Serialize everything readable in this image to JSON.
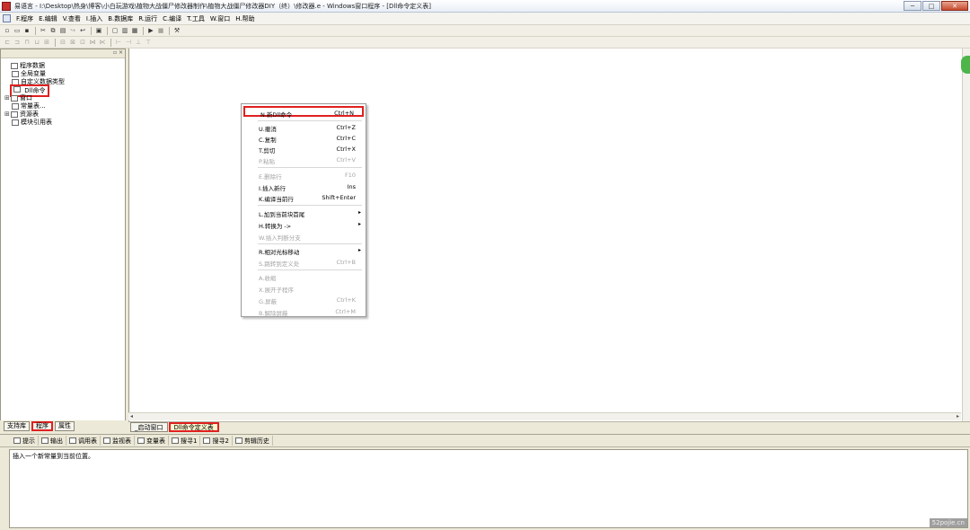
{
  "window": {
    "title": "易语言 - I:\\Desktop\\热身\\博客\\小白玩游戏\\植物大战僵尸修改器制作\\植物大战僵尸修改器DIY（终）\\修改器.e - Windows窗口程序 - [Dll命令定义表]",
    "minimize": "─",
    "maximize": "□",
    "close": "✕"
  },
  "menubar": [
    "F.程序",
    "E.编辑",
    "V.查看",
    "I.插入",
    "B.数据库",
    "R.运行",
    "C.编译",
    "T.工具",
    "W.窗口",
    "H.帮助"
  ],
  "left_panel": {
    "pin": "▫ ×",
    "tree": [
      {
        "label": "程序数据",
        "expander": "",
        "indent": 0
      },
      {
        "label": "全局变量",
        "expander": "",
        "indent": 1
      },
      {
        "label": "自定义数据类型",
        "expander": "",
        "indent": 1
      },
      {
        "label": "Dll命令",
        "expander": "",
        "indent": 1,
        "highlight": true
      },
      {
        "label": "窗口",
        "expander": "⊞",
        "indent": 0
      },
      {
        "label": "常量表...",
        "expander": "",
        "indent": 1
      },
      {
        "label": "资源表",
        "expander": "⊞",
        "indent": 0
      },
      {
        "label": "模块引用表",
        "expander": "",
        "indent": 1
      }
    ],
    "tabs": [
      {
        "label": "支持库",
        "highlight": false
      },
      {
        "label": "程序",
        "highlight": true
      },
      {
        "label": "属性",
        "highlight": false
      }
    ]
  },
  "context_menu": {
    "items": [
      {
        "label": "N.新Dll命令",
        "shortcut": "Ctrl+N",
        "disabled": false,
        "arrow": false,
        "first": true
      },
      {
        "sep": true
      },
      {
        "label": "U.撤消",
        "shortcut": "Ctrl+Z",
        "disabled": false,
        "arrow": false
      },
      {
        "label": "C.复制",
        "shortcut": "Ctrl+C",
        "disabled": false,
        "arrow": false
      },
      {
        "label": "T.剪切",
        "shortcut": "Ctrl+X",
        "disabled": false,
        "arrow": false
      },
      {
        "label": "P.粘贴",
        "shortcut": "Ctrl+V",
        "disabled": true,
        "arrow": false
      },
      {
        "sep": true
      },
      {
        "label": "E.删除行",
        "shortcut": "F10",
        "disabled": true,
        "arrow": false
      },
      {
        "label": "I.插入新行",
        "shortcut": "Ins",
        "disabled": false,
        "arrow": false
      },
      {
        "label": "K.编译当前行",
        "shortcut": "Shift+Enter",
        "disabled": false,
        "arrow": false
      },
      {
        "sep": true
      },
      {
        "label": "L.加到当前块首尾",
        "shortcut": "",
        "disabled": false,
        "arrow": true
      },
      {
        "label": "H.转换为 ->",
        "shortcut": "",
        "disabled": false,
        "arrow": true
      },
      {
        "label": "W.插入判断分支",
        "shortcut": "",
        "disabled": true,
        "arrow": false
      },
      {
        "sep": true
      },
      {
        "label": "R.相对光标移动",
        "shortcut": "",
        "disabled": false,
        "arrow": true
      },
      {
        "label": "S.跳转到定义处",
        "shortcut": "Ctrl+B",
        "disabled": true,
        "arrow": false
      },
      {
        "sep": true
      },
      {
        "label": "A.收缩",
        "shortcut": "",
        "disabled": true,
        "arrow": false
      },
      {
        "label": "X.展开子程序",
        "shortcut": "",
        "disabled": true,
        "arrow": false
      },
      {
        "label": "G.屏蔽",
        "shortcut": "Ctrl+K",
        "disabled": true,
        "arrow": false
      },
      {
        "label": "B.解除屏蔽",
        "shortcut": "Ctrl+M",
        "disabled": true,
        "arrow": false
      }
    ]
  },
  "doc_tabs": [
    {
      "label": "_启动窗口",
      "active": false
    },
    {
      "label": "Dll命令定义表",
      "active": true
    }
  ],
  "bottom_panel": {
    "tabs": [
      "提示",
      "输出",
      "调用表",
      "监视表",
      "变量表",
      "搜寻1",
      "搜寻2",
      "剪辑历史"
    ],
    "message": "插入一个新常量到当前位置。"
  },
  "watermark": "52pojie.cn",
  "colors": {
    "highlight_red": "#e02020",
    "active_tab_bg": "#fbf6cf"
  }
}
